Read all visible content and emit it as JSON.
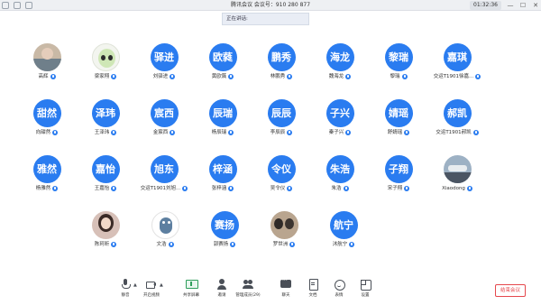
{
  "window": {
    "title": "腾讯会议  会议号：910 280 877",
    "timer": "01:32:36",
    "minimize": "—",
    "maximize": "☐",
    "close": "✕"
  },
  "speaking_banner": "正在讲话:",
  "participants": [
    {
      "avatar": "photo",
      "initials": "",
      "name": "高辉",
      "mic": "on"
    },
    {
      "avatar": "alien-toy",
      "initials": "",
      "name": "梁家翔",
      "mic": "muted"
    },
    {
      "avatar": "text",
      "initials": "驿进",
      "name": "刘驿进",
      "mic": "muted"
    },
    {
      "avatar": "text",
      "initials": "欧蕤",
      "name": "黄欧蕤",
      "mic": "muted"
    },
    {
      "avatar": "text",
      "initials": "鹏秀",
      "name": "林鹏秀",
      "mic": "on"
    },
    {
      "avatar": "text",
      "initials": "海龙",
      "name": "魏海龙",
      "mic": "muted"
    },
    {
      "avatar": "text",
      "initials": "黎瑞",
      "name": "黎瑞",
      "mic": "muted"
    },
    {
      "avatar": "text",
      "initials": "嘉琪",
      "name": "交运T1901徐嘉...",
      "mic": "muted"
    },
    {
      "avatar": "text",
      "initials": "甜然",
      "name": "向甜然",
      "mic": "muted"
    },
    {
      "avatar": "text",
      "initials": "泽玮",
      "name": "王泽玮",
      "mic": "muted"
    },
    {
      "avatar": "text",
      "initials": "宸西",
      "name": "金宸西",
      "mic": "muted"
    },
    {
      "avatar": "text",
      "initials": "辰瑞",
      "name": "杨辰瑞",
      "mic": "muted"
    },
    {
      "avatar": "text",
      "initials": "辰辰",
      "name": "李辰辰",
      "mic": "muted"
    },
    {
      "avatar": "text",
      "initials": "子兴",
      "name": "秦子兴",
      "mic": "muted"
    },
    {
      "avatar": "text",
      "initials": "婧瑶",
      "name": "舒婧瑶",
      "mic": "muted"
    },
    {
      "avatar": "text",
      "initials": "郝凯",
      "name": "交运T1901郝凯",
      "mic": "muted"
    },
    {
      "avatar": "text",
      "initials": "雅然",
      "name": "杨雅然",
      "mic": "muted"
    },
    {
      "avatar": "text",
      "initials": "嘉怡",
      "name": "王嘉怡",
      "mic": "muted"
    },
    {
      "avatar": "text",
      "initials": "旭东",
      "name": "交运T1901刘旭...",
      "mic": "muted"
    },
    {
      "avatar": "text",
      "initials": "梓涵",
      "name": "张梓涵",
      "mic": "muted"
    },
    {
      "avatar": "text",
      "initials": "令仪",
      "name": "吴令仪",
      "mic": "muted"
    },
    {
      "avatar": "text",
      "initials": "朱浩",
      "name": "朱浩",
      "mic": "muted"
    },
    {
      "avatar": "text",
      "initials": "子翔",
      "name": "宋子翔",
      "mic": "muted"
    },
    {
      "avatar": "car-photo",
      "initials": "",
      "name": "Xiaodong",
      "mic": "muted"
    },
    {
      "avatar": "woman-photo",
      "initials": "",
      "name": "陈珂昕",
      "mic": "muted"
    },
    {
      "avatar": "ghost",
      "initials": "",
      "name": "文浩",
      "mic": "muted"
    },
    {
      "avatar": "text",
      "initials": "赛扬",
      "name": "郭赛扬",
      "mic": "muted"
    },
    {
      "avatar": "duo-photo",
      "initials": "",
      "name": "罗世洲",
      "mic": "muted"
    },
    {
      "avatar": "text",
      "initials": "航宁",
      "name": "沐航宁",
      "mic": "muted"
    }
  ],
  "toolbar": {
    "items": [
      {
        "icon": "microphone-icon",
        "label": "静音",
        "caret": true
      },
      {
        "icon": "camera-icon",
        "label": "开启视频",
        "caret": true
      },
      {
        "icon": "screen-share-icon",
        "label": "共享屏幕",
        "caret": false
      },
      {
        "icon": "invite-icon",
        "label": "邀请",
        "caret": false
      },
      {
        "icon": "members-icon",
        "label": "管理成员(29)",
        "caret": false
      },
      {
        "icon": "chat-icon",
        "label": "聊天",
        "caret": false
      },
      {
        "icon": "document-icon",
        "label": "文档",
        "caret": false
      },
      {
        "icon": "emoji-icon",
        "label": "表情",
        "caret": false
      },
      {
        "icon": "settings-icon",
        "label": "设置",
        "caret": false
      }
    ],
    "end_meeting": "结束会议"
  },
  "colors": {
    "accent": "#2a7cf0",
    "end_meeting": "#e5484d",
    "share": "#2e9e5b"
  }
}
